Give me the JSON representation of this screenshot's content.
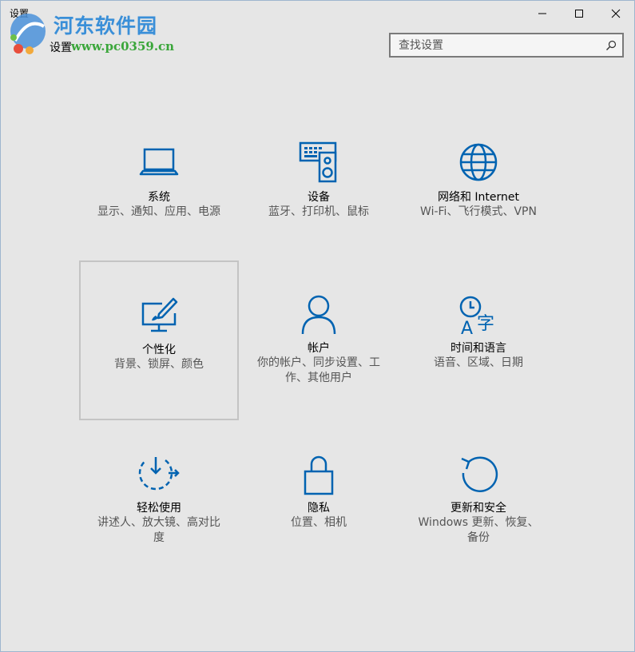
{
  "window": {
    "titlebar_label": "设置",
    "page_title": "设置",
    "watermark_title": "河东软件园",
    "watermark_url": "www.pc0359.cn"
  },
  "search": {
    "placeholder": "查找设置"
  },
  "tiles": [
    {
      "title": "系统",
      "desc": "显示、通知、应用、电源",
      "icon": "laptop-icon"
    },
    {
      "title": "设备",
      "desc": "蓝牙、打印机、鼠标",
      "icon": "devices-icon"
    },
    {
      "title": "网络和 Internet",
      "desc": "Wi-Fi、飞行模式、VPN",
      "icon": "globe-icon"
    },
    {
      "title": "个性化",
      "desc": "背景、锁屏、颜色",
      "icon": "personalization-icon"
    },
    {
      "title": "帐户",
      "desc": "你的帐户、同步设置、工作、其他用户",
      "icon": "person-icon"
    },
    {
      "title": "时间和语言",
      "desc": "语音、区域、日期",
      "icon": "time-language-icon"
    },
    {
      "title": "轻松使用",
      "desc": "讲述人、放大镜、高对比度",
      "icon": "ease-of-access-icon"
    },
    {
      "title": "隐私",
      "desc": "位置、相机",
      "icon": "lock-icon"
    },
    {
      "title": "更新和安全",
      "desc": "Windows 更新、恢复、备份",
      "icon": "refresh-icon"
    }
  ],
  "colors": {
    "accent": "#0063b1",
    "background": "#e6e6e6",
    "desc_text": "#555555"
  }
}
